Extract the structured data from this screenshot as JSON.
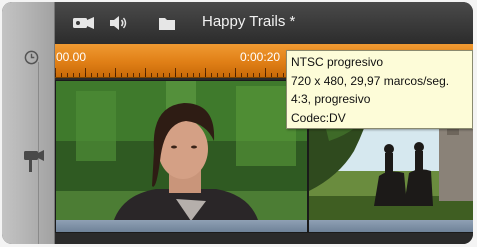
{
  "titlebar": {
    "project_title": "Happy Trails *",
    "icons": [
      "camcorder-icon",
      "speaker-icon",
      "folder-icon"
    ]
  },
  "left_panel": {
    "icons": [
      "clock-icon",
      "video-track-icon"
    ]
  },
  "ruler": {
    "labels": [
      "00.00",
      "0:00:20"
    ],
    "color": "#e8871e"
  },
  "clips": [
    {
      "name": "girl-portrait-clip"
    },
    {
      "name": "horse-riders-clip"
    }
  ],
  "tooltip": {
    "lines": [
      "NTSC progresivo",
      "720 x 480, 29,97 marcos/seg.",
      "4:3, progresivo",
      "Codec:DV"
    ],
    "background": "#fdfcd8"
  }
}
